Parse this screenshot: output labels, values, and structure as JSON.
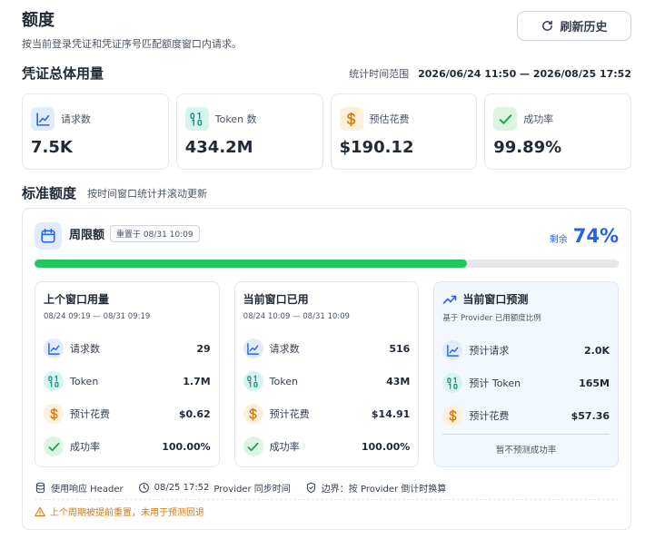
{
  "header": {
    "title": "额度",
    "subtitle": "按当前登录凭证和凭证序号匹配额度窗口内请求。",
    "refresh_label": "刷新历史"
  },
  "usage": {
    "title": "凭证总体用量",
    "range_label": "统计时间范围",
    "range_value": "2026/06/24 11:50 — 2026/08/25 17:52",
    "cards": [
      {
        "icon": "chart-line-icon",
        "label": "请求数",
        "value": "7.5K",
        "color": "#2563eb",
        "bg": "#e0ecfb"
      },
      {
        "icon": "binary-icon",
        "label": "Token 数",
        "value": "434.2M",
        "color": "#0d9488",
        "bg": "#d7f3ee"
      },
      {
        "icon": "dollar-icon",
        "label": "预估花费",
        "value": "$190.12",
        "color": "#d97706",
        "bg": "#fdf0d8"
      },
      {
        "icon": "check-icon",
        "label": "成功率",
        "value": "99.89%",
        "color": "#16a34a",
        "bg": "#dcf5e3"
      }
    ]
  },
  "standard": {
    "title": "标准额度",
    "note": "按时间窗口统计并滚动更新"
  },
  "quota": {
    "name": "周限额",
    "reset_badge": "重置于 08/31 10:09",
    "remain_label": "剩余",
    "remain_value": "74%",
    "used_fraction": 0.74,
    "panels": [
      {
        "title": "上个窗口用量",
        "sub": "08/24 09:19 — 08/31 09:19",
        "rows": [
          {
            "label": "请求数",
            "value": "29"
          },
          {
            "label": "Token",
            "value": "1.7M"
          },
          {
            "label": "预计花费",
            "value": "$0.62"
          },
          {
            "label": "成功率",
            "value": "100.00%"
          }
        ]
      },
      {
        "title": "当前窗口已用",
        "sub": "08/24 10:09 — 08/31 10:09",
        "rows": [
          {
            "label": "请求数",
            "value": "516"
          },
          {
            "label": "Token",
            "value": "43M"
          },
          {
            "label": "预计花费",
            "value": "$14.91"
          },
          {
            "label": "成功率",
            "value": "100.00%"
          }
        ]
      },
      {
        "title": "当前窗口预测",
        "sub": "基于 Provider 已用额度比例",
        "rows": [
          {
            "label": "预计请求",
            "value": "2.0K"
          },
          {
            "label": "预计 Token",
            "value": "165M"
          },
          {
            "label": "预计花费",
            "value": "$57.36"
          }
        ],
        "note": "暂不预测成功率"
      }
    ],
    "footer": {
      "source": "使用响应 Header",
      "time": "08/25 17:52",
      "time_note": "Provider 同步时间",
      "boundary": "边界：按 Provider 倒计时换算"
    },
    "warning": "上个周期被提前重置，未用于预测回退"
  }
}
